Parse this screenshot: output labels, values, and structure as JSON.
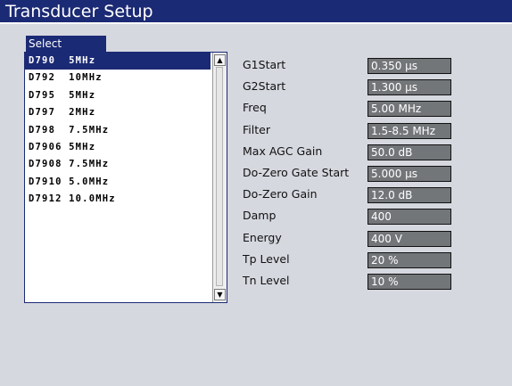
{
  "window": {
    "title": "Transducer Setup"
  },
  "select": {
    "tab_label": "Select",
    "items": [
      {
        "model": "D790",
        "freq": "5MHz"
      },
      {
        "model": "D792",
        "freq": "10MHz"
      },
      {
        "model": "D795",
        "freq": "5MHz"
      },
      {
        "model": "D797",
        "freq": "2MHz"
      },
      {
        "model": "D798",
        "freq": "7.5MHz"
      },
      {
        "model": "D7906",
        "freq": "5MHz"
      },
      {
        "model": "D7908",
        "freq": "7.5MHz"
      },
      {
        "model": "D7910",
        "freq": "5.0MHz"
      },
      {
        "model": "D7912",
        "freq": "10.0MHz"
      }
    ],
    "selected_index": 0
  },
  "params": [
    {
      "label": "G1Start",
      "value": "0.350  µs"
    },
    {
      "label": "G2Start",
      "value": "1.300  µs"
    },
    {
      "label": "Freq",
      "value": "5.00 MHz"
    },
    {
      "label": "Filter",
      "value": "1.5-8.5 MHz"
    },
    {
      "label": "Max AGC Gain",
      "value": "50.0 dB"
    },
    {
      "label": "Do-Zero Gate Start",
      "value": "5.000  µs"
    },
    {
      "label": "Do-Zero Gain",
      "value": "12.0 dB"
    },
    {
      "label": "Damp",
      "value": "400"
    },
    {
      "label": "Energy",
      "value": "400 V"
    },
    {
      "label": "Tp Level",
      "value": "20 %"
    },
    {
      "label": "Tn Level",
      "value": "10 %"
    }
  ],
  "icons": {
    "scroll_up": "triangle-up-icon",
    "scroll_down": "triangle-down-icon"
  },
  "colors": {
    "accent": "#1b2a74",
    "background": "#d6d8e0",
    "value_box": "#737679"
  }
}
